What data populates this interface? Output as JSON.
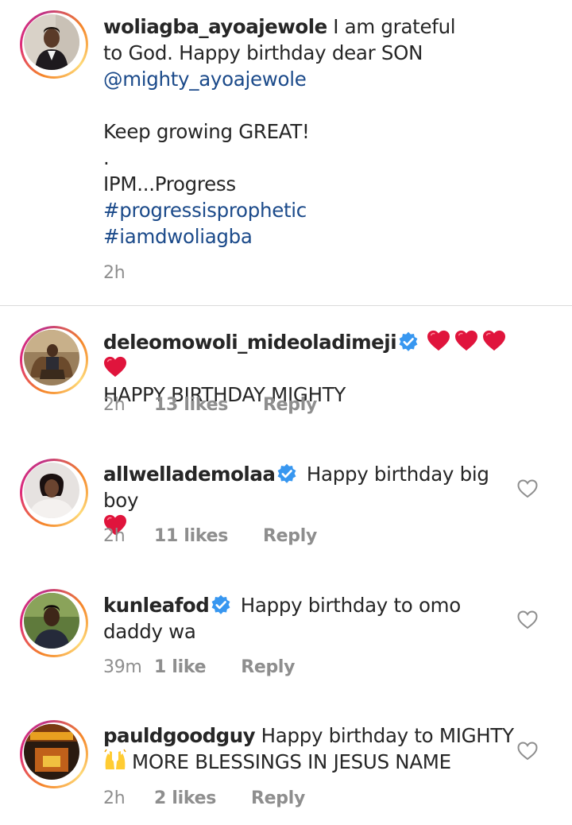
{
  "caption": {
    "username": "woliagba_ayoajewole",
    "text_1": " I am grateful",
    "line_2": "to God. Happy birthday dear SON",
    "mention": "@mighty_ayoajewole",
    "line_4": "Keep growing GREAT!",
    "line_5": ".",
    "line_6": "IPM...Progress",
    "hashtag_1": "#progressisprophetic",
    "hashtag_2": "#iamdwoliagba",
    "time": "2h"
  },
  "comments": [
    {
      "username": "deleomowoli_mideoladimeji",
      "verified": true,
      "text_line_1": "",
      "hearts": 4,
      "text_line_2": "HAPPY BIRTHDAY MIGHTY",
      "time": "2h",
      "likes": "13 likes",
      "reply": "Reply"
    },
    {
      "username": "allwellademolaa",
      "verified": true,
      "text_line_1": " Happy birthday big boy",
      "hearts": 1,
      "time": "2h",
      "likes": "11 likes",
      "reply": "Reply"
    },
    {
      "username": "kunleafod",
      "verified": true,
      "text_line_1": " Happy birthday to omo",
      "text_line_2": "daddy wa",
      "time": "39m",
      "likes": "1 like",
      "reply": "Reply"
    },
    {
      "username": "pauldgoodguy",
      "verified": false,
      "text_line_1": " Happy birthday to MIGHTY",
      "text_line_2": "MORE BLESSINGS IN JESUS NAME",
      "time": "2h",
      "likes": "2 likes",
      "reply": "Reply"
    }
  ],
  "colors": {
    "link": "#1b4a8a",
    "verified": "#3897f0",
    "heart": "#e0143c",
    "muted": "#8e8e8e"
  },
  "icons": {
    "verified": "verified-badge-icon",
    "heart": "red-heart-emoji",
    "like": "heart-outline-icon",
    "raised_hands": "raised-hands-emoji"
  }
}
